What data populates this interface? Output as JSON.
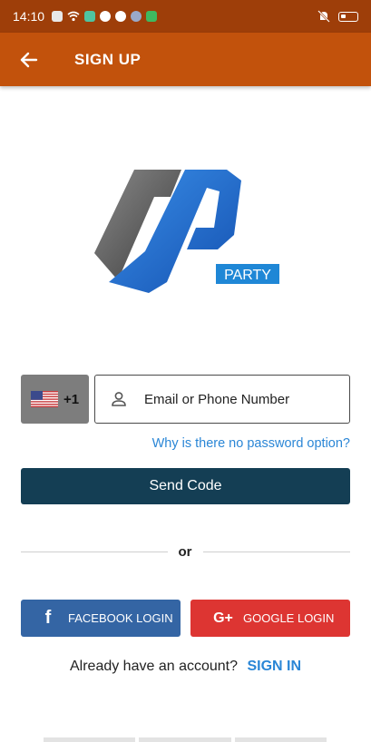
{
  "status_bar": {
    "time": "14:10",
    "notification_icons": [
      "message-icon",
      "wifi-icon",
      "app-icon",
      "gmail-icon",
      "mi-icon",
      "settings-icon",
      "sparkle-icon"
    ],
    "right_icons": [
      "silent-icon",
      "battery-icon"
    ]
  },
  "app_bar": {
    "title": "SIGN UP",
    "background_color": "#c2520c",
    "back_icon": "arrow-left-icon"
  },
  "logo": {
    "word": "PARTY",
    "brand_colors": [
      "#555555",
      "#1e6fd6"
    ]
  },
  "form": {
    "country_code": "+1",
    "flag_icon": "us-flag-icon",
    "email_placeholder": "Email or Phone Number",
    "why_link": "Why is there no password option?",
    "send_button": "Send Code",
    "send_button_color": "#143e54"
  },
  "divider": {
    "text": "or"
  },
  "social": {
    "facebook_label": "FACEBOOK LOGIN",
    "facebook_icon_text": "f",
    "facebook_color": "#3465a4",
    "google_label": "GOOGLE LOGIN",
    "google_icon_text": "G+",
    "google_color": "#dd3532"
  },
  "footer": {
    "prompt": "Already have an account?",
    "signin": "SIGN IN"
  }
}
